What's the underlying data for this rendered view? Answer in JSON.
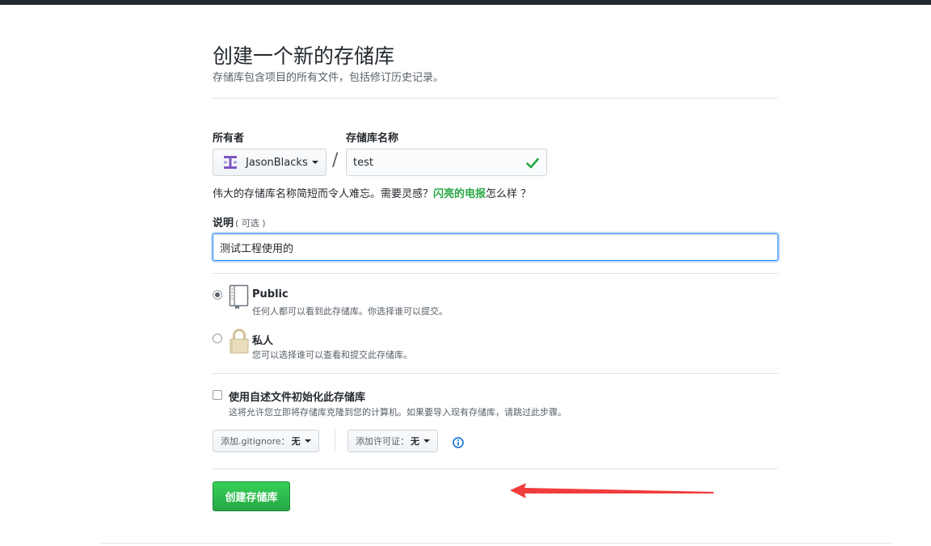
{
  "header": {
    "title": "创建一个新的存储库",
    "subtitle": "存储库包含项目的所有文件，包括修订历史记录。"
  },
  "owner": {
    "label": "所有者",
    "name": "JasonBlacks"
  },
  "repo_name": {
    "label": "存储库名称",
    "value": "test"
  },
  "name_help": {
    "prefix": "伟大的存储库名称简短而令人难忘。需要灵感？",
    "suggestion": "闪亮的电报",
    "suffix": "怎么样 ？"
  },
  "description": {
    "label": "说明",
    "optional": "( 可选 )",
    "value": "测试工程使用的"
  },
  "visibility": {
    "public": {
      "title": "Public",
      "desc": "任何人都可以看到此存储库。你选择谁可以提交。",
      "checked": true
    },
    "private": {
      "title": "私人",
      "desc": "您可以选择谁可以查看和提交此存储库。",
      "checked": false
    }
  },
  "init": {
    "title": "使用自述文件初始化此存储库",
    "desc": "这将允许您立即将存储库克隆到您的计算机。如果要导入现有存储库，请跳过此步骤。",
    "checked": false
  },
  "gitignore": {
    "label": "添加.gitignore：",
    "value": "无"
  },
  "license": {
    "label": "添加许可证：",
    "value": "无"
  },
  "create_button": "创建存储库",
  "colors": {
    "accent_green": "#28a745",
    "focus_blue": "#2188ff",
    "annotation_red": "#f03c3c"
  }
}
